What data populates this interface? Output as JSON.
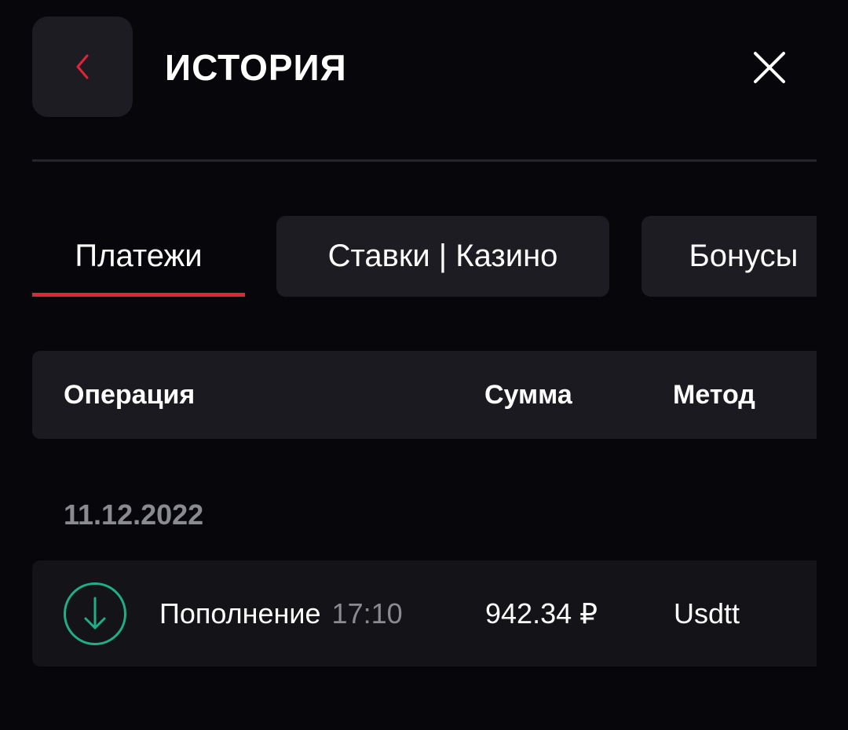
{
  "header": {
    "title": "ИСТОРИЯ",
    "back_icon": "chevron-left-icon",
    "close_icon": "close-icon",
    "accent_color": "#e0253a"
  },
  "tabs": [
    {
      "label": "Платежи",
      "active": true
    },
    {
      "label": "Ставки | Казино",
      "active": false
    },
    {
      "label": "Бонусы",
      "active": false
    }
  ],
  "table": {
    "columns": [
      "Операция",
      "Сумма",
      "Метод"
    ],
    "groups": [
      {
        "date": "11.12.2022",
        "rows": [
          {
            "icon": "deposit-arrow-down-icon",
            "icon_color": "#1fae86",
            "operation": "Пополнение",
            "time": "17:10",
            "amount": "942.34 ₽",
            "method": "Usdtt"
          }
        ]
      }
    ]
  }
}
